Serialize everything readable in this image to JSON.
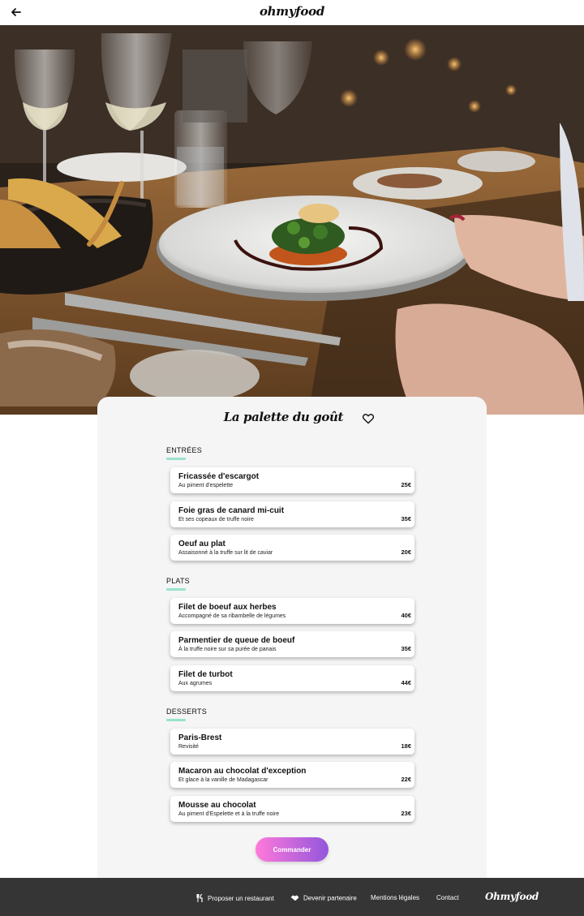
{
  "header": {
    "logo": "ohmyfood",
    "back_icon": "arrow-left-icon"
  },
  "hero": {
    "image": "restaurant-dish-photo"
  },
  "restaurant": {
    "title": "La palette du goût",
    "favorite_icon": "heart-outline-icon"
  },
  "menu": {
    "sections": [
      {
        "label": "ENTRÉES",
        "dishes": [
          {
            "name": "Fricassée d'escargot",
            "description": "Au piment d'espelette",
            "price": "25€"
          },
          {
            "name": "Foie gras de canard mi-cuit",
            "description": "Et ses copeaux de truffe noire",
            "price": "35€"
          },
          {
            "name": "Oeuf au plat",
            "description": "Assaisonné à la truffe sur lit de caviar",
            "price": "20€"
          }
        ]
      },
      {
        "label": "PLATS",
        "dishes": [
          {
            "name": "Filet de boeuf aux herbes",
            "description": "Accompagné de sa ribambelle de légumes",
            "price": "40€"
          },
          {
            "name": "Parmentier de queue de boeuf",
            "description": "À la truffe noire sur sa purée de panais",
            "price": "35€"
          },
          {
            "name": "Filet de turbot",
            "description": "Aux agrumes",
            "price": "44€"
          }
        ]
      },
      {
        "label": "DESSERTS",
        "dishes": [
          {
            "name": "Paris-Brest",
            "description": "Revisité",
            "price": "18€"
          },
          {
            "name": "Macaron au chocolat d'exception",
            "description": "Et glace à la vanille de Madagascar",
            "price": "22€"
          },
          {
            "name": "Mousse au chocolat",
            "description": "Au piment d'Espelette et à la truffe noire",
            "price": "23€"
          }
        ]
      }
    ],
    "order_button": "Commander"
  },
  "footer": {
    "links": [
      {
        "label": "Proposer un restaurant",
        "icon": "fork-knife-icon"
      },
      {
        "label": "Devenir partenaire",
        "icon": "handshake-icon"
      },
      {
        "label": "Mentions légales"
      },
      {
        "label": "Contact"
      }
    ],
    "logo": "Ohmyfood"
  },
  "colors": {
    "accent_bar": "#99e2d0",
    "button_gradient_start": "#ff79da",
    "button_gradient_end": "#9356dc",
    "footer_bg": "#353535",
    "card_bg": "#f5f5f5"
  }
}
